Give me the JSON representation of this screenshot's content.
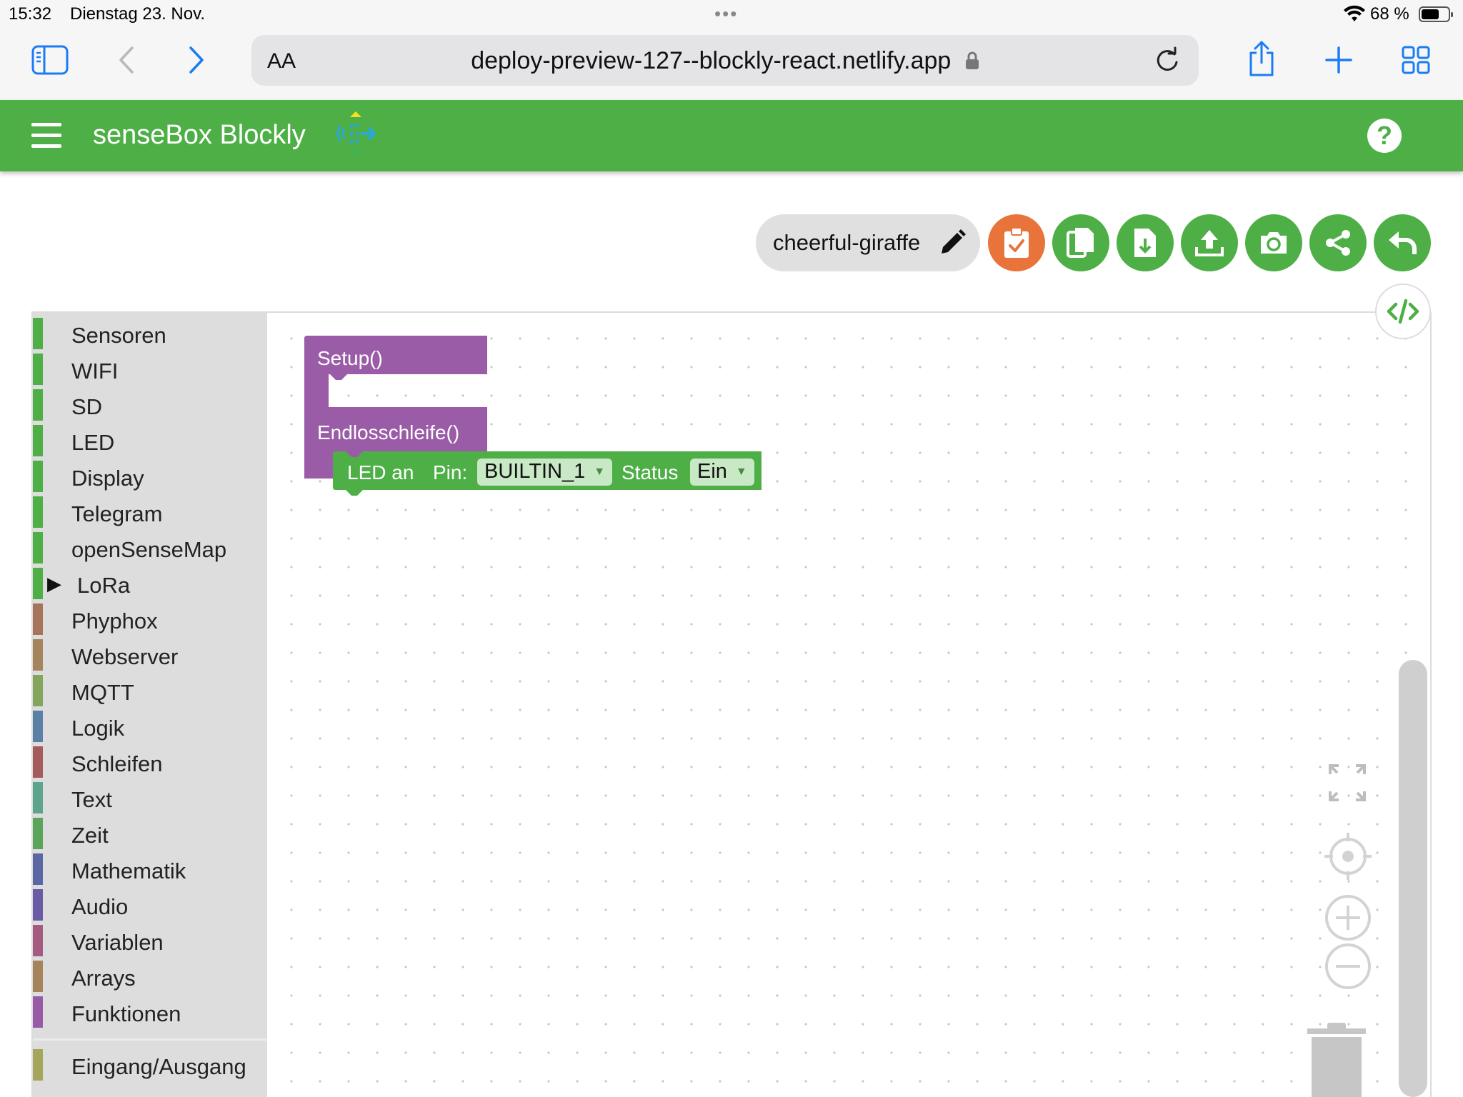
{
  "status": {
    "time": "15:32",
    "date": "Dienstag 23. Nov.",
    "battery": "68 %",
    "battery_level": 0.68
  },
  "browser": {
    "text_size": "AA",
    "url": "deploy-preview-127--blockly-react.netlify.app"
  },
  "app": {
    "title": "senseBox Blockly",
    "help": "?"
  },
  "project": {
    "name": "cheerful-giraffe"
  },
  "toolbox": {
    "categories": [
      {
        "label": "Sensoren",
        "color": "#4eaf47"
      },
      {
        "label": "WIFI",
        "color": "#4eaf47"
      },
      {
        "label": "SD",
        "color": "#4eaf47"
      },
      {
        "label": "LED",
        "color": "#4eaf47"
      },
      {
        "label": "Display",
        "color": "#4eaf47"
      },
      {
        "label": "Telegram",
        "color": "#4eaf47"
      },
      {
        "label": "openSenseMap",
        "color": "#4eaf47"
      },
      {
        "label": "LoRa",
        "color": "#4eaf47",
        "expandable": true
      },
      {
        "label": "Phyphox",
        "color": "#a5745b"
      },
      {
        "label": "Webserver",
        "color": "#a5835b"
      },
      {
        "label": "MQTT",
        "color": "#84a55b"
      },
      {
        "label": "Logik",
        "color": "#5b80a5"
      },
      {
        "label": "Schleifen",
        "color": "#a55b5b"
      },
      {
        "label": "Text",
        "color": "#5ba58c"
      },
      {
        "label": "Zeit",
        "color": "#5ba55b"
      },
      {
        "label": "Mathematik",
        "color": "#5b67a5"
      },
      {
        "label": "Audio",
        "color": "#6a5ba5"
      },
      {
        "label": "Variablen",
        "color": "#a55b80"
      },
      {
        "label": "Arrays",
        "color": "#a5835b"
      },
      {
        "label": "Funktionen",
        "color": "#995ba5"
      }
    ],
    "extra": {
      "label": "Eingang/Ausgang",
      "color": "#a5a55b"
    }
  },
  "blocks": {
    "setup_label": "Setup()",
    "loop_label": "Endlosschleife()",
    "led": {
      "prefix": "LED an",
      "pin_label": "Pin:",
      "pin_value": "BUILTIN_1",
      "status_label": "Status",
      "status_value": "Ein"
    },
    "colors": {
      "main": "#9a5ca6",
      "led": "#4eaf47"
    }
  }
}
